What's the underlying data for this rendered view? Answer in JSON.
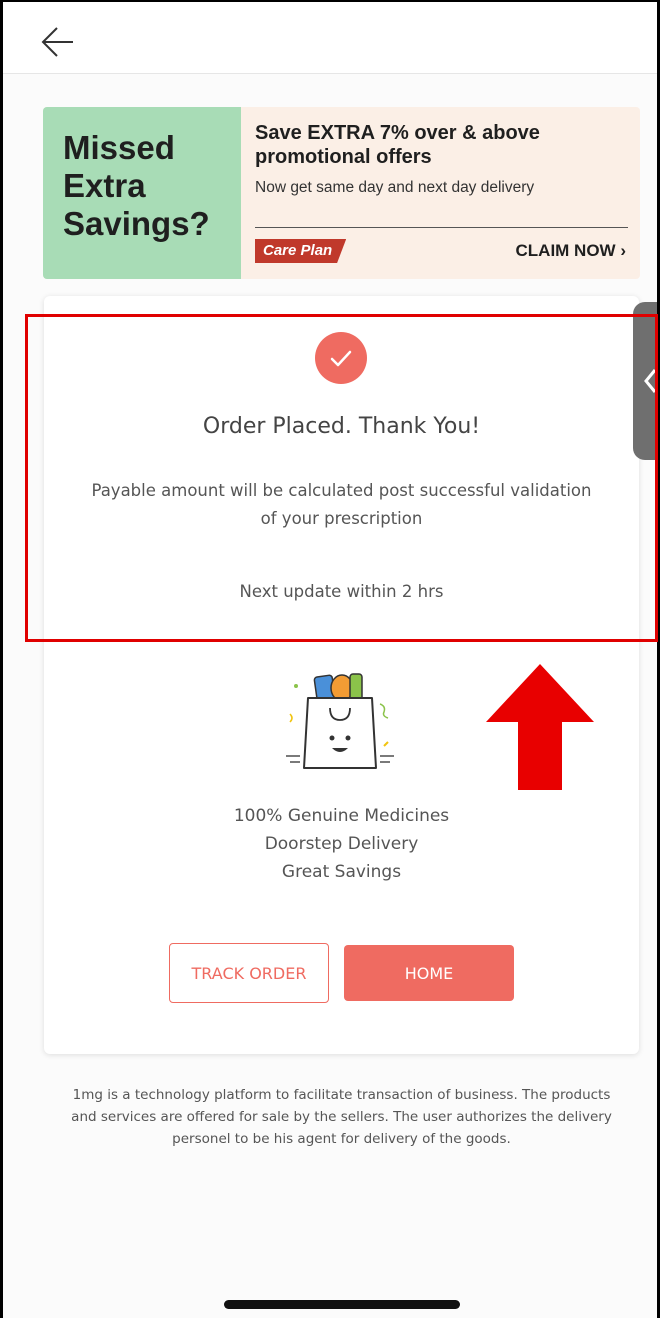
{
  "banner": {
    "headline_lines": [
      "Missed",
      "Extra",
      "Savings?"
    ],
    "offer": "Save EXTRA 7% over & above promotional offers",
    "subtext": "Now get same day and next day delivery",
    "badge": "Care Plan",
    "cta": "CLAIM NOW ›",
    "colors": {
      "left_bg": "#a8dcb6",
      "right_bg": "#fbefe6",
      "badge_bg": "#c0392b"
    }
  },
  "order": {
    "title": "Order Placed. Thank You!",
    "payable_note": "Payable amount will be calculated post successful validation of your prescription",
    "next_update": "Next update within 2 hrs"
  },
  "benefits": [
    "100% Genuine Medicines",
    "Doorstep Delivery",
    "Great Savings"
  ],
  "actions": {
    "track_label": "TRACK ORDER",
    "home_label": "HOME"
  },
  "disclaimer": "1mg is a technology platform to facilitate transaction of business. The products and services are offered for sale by the sellers. The user authorizes the delivery personel to be his agent for delivery of the goods.",
  "icons": {
    "back": "arrow-left-icon",
    "success": "check-circle-icon",
    "illustration": "shopping-bag-icon",
    "side_tab": "chevron-left-icon",
    "annotation": "red-up-arrow"
  },
  "colors": {
    "accent": "#ef6b61",
    "annotation_red": "#e00000"
  }
}
